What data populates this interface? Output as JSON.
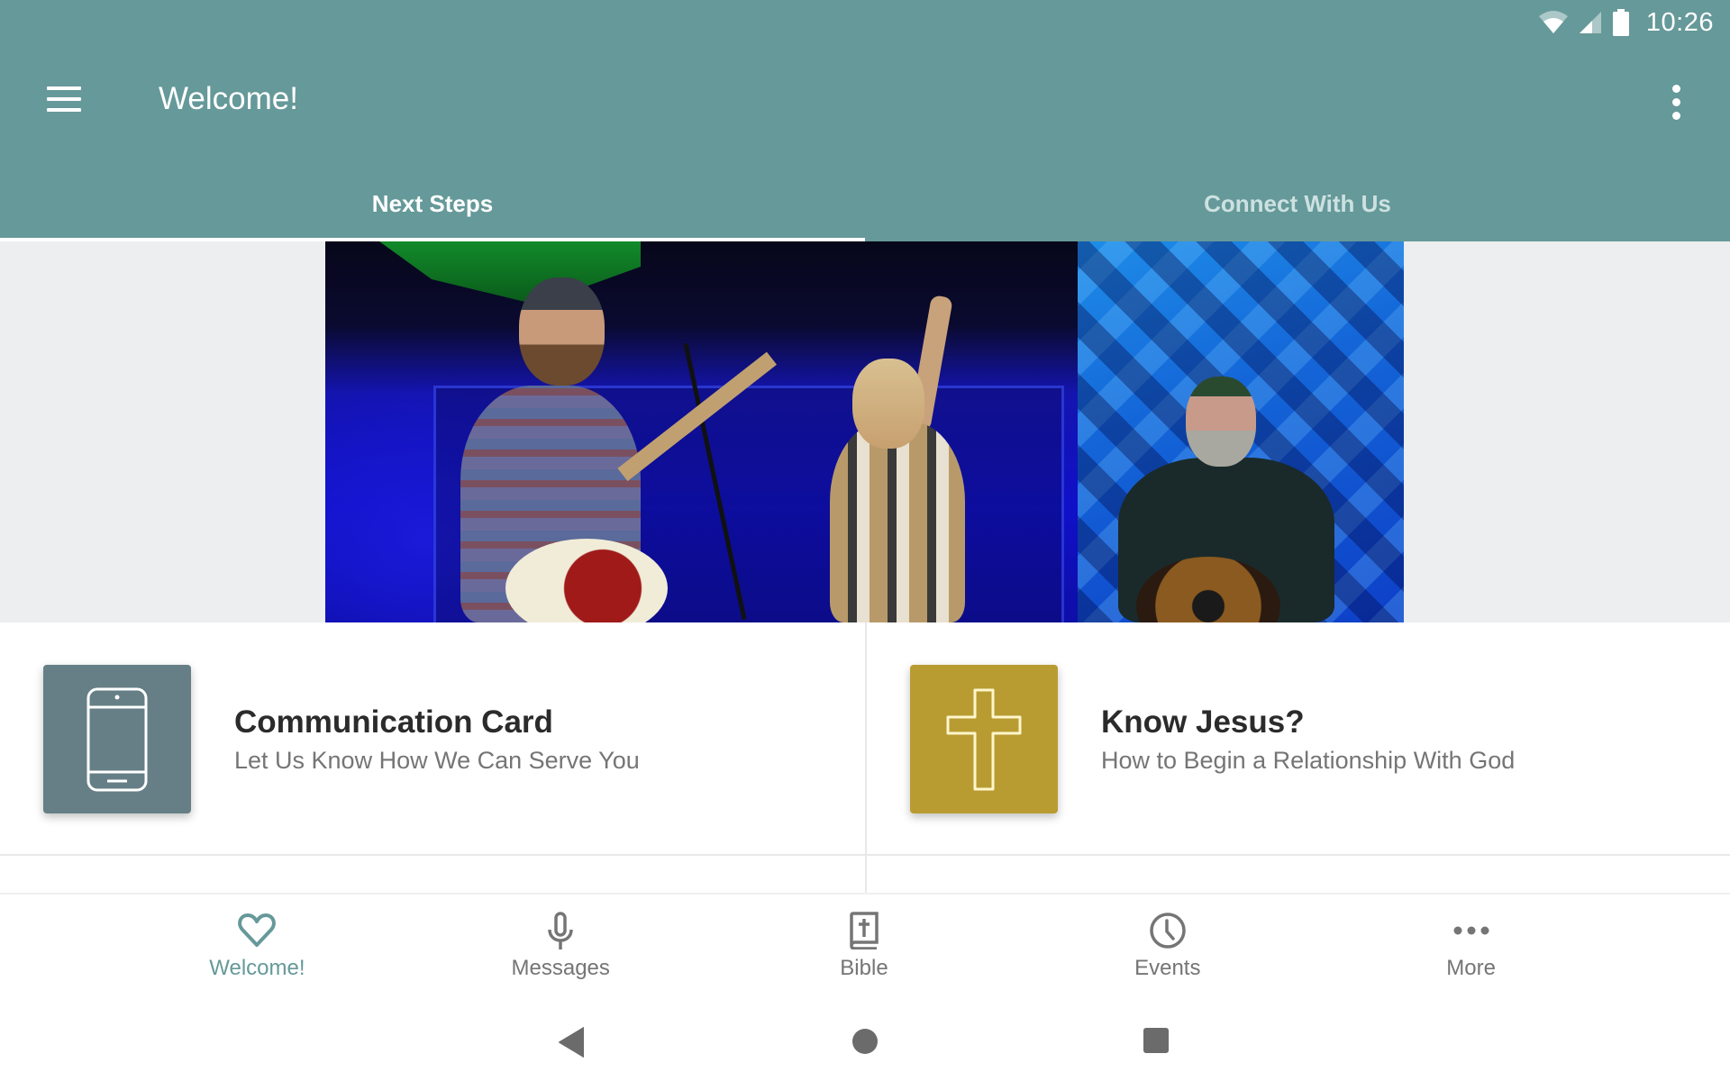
{
  "status_bar": {
    "time": "10:26",
    "icons": [
      "wifi-icon",
      "cellular-signal-icon",
      "battery-icon"
    ]
  },
  "app_bar": {
    "title": "Welcome!",
    "menu_icon": "hamburger-menu-icon",
    "overflow_icon": "more-vert-icon",
    "background_color": "#669999"
  },
  "tabs": [
    {
      "label": "Next Steps",
      "active": true
    },
    {
      "label": "Connect With Us",
      "active": false
    }
  ],
  "hero": {
    "description": "Worship band performing on stage with blue lighting"
  },
  "cards": [
    {
      "title": "Communication Card",
      "subtitle": "Let Us Know How We Can Serve You",
      "icon": "smartphone-icon",
      "icon_bg": "#667f86"
    },
    {
      "title": "Know Jesus?",
      "subtitle": "How to Begin a Relationship With God",
      "icon": "cross-icon",
      "icon_bg": "#b89c32"
    }
  ],
  "bottom_nav": {
    "active_color": "#669999",
    "inactive_color": "#757575",
    "items": [
      {
        "label": "Welcome!",
        "icon": "heart-icon",
        "active": true
      },
      {
        "label": "Messages",
        "icon": "microphone-icon",
        "active": false
      },
      {
        "label": "Bible",
        "icon": "bible-icon",
        "active": false
      },
      {
        "label": "Events",
        "icon": "clock-icon",
        "active": false
      },
      {
        "label": "More",
        "icon": "more-horiz-icon",
        "active": false
      }
    ]
  },
  "system_nav": {
    "buttons": [
      "back",
      "home",
      "recents"
    ]
  }
}
